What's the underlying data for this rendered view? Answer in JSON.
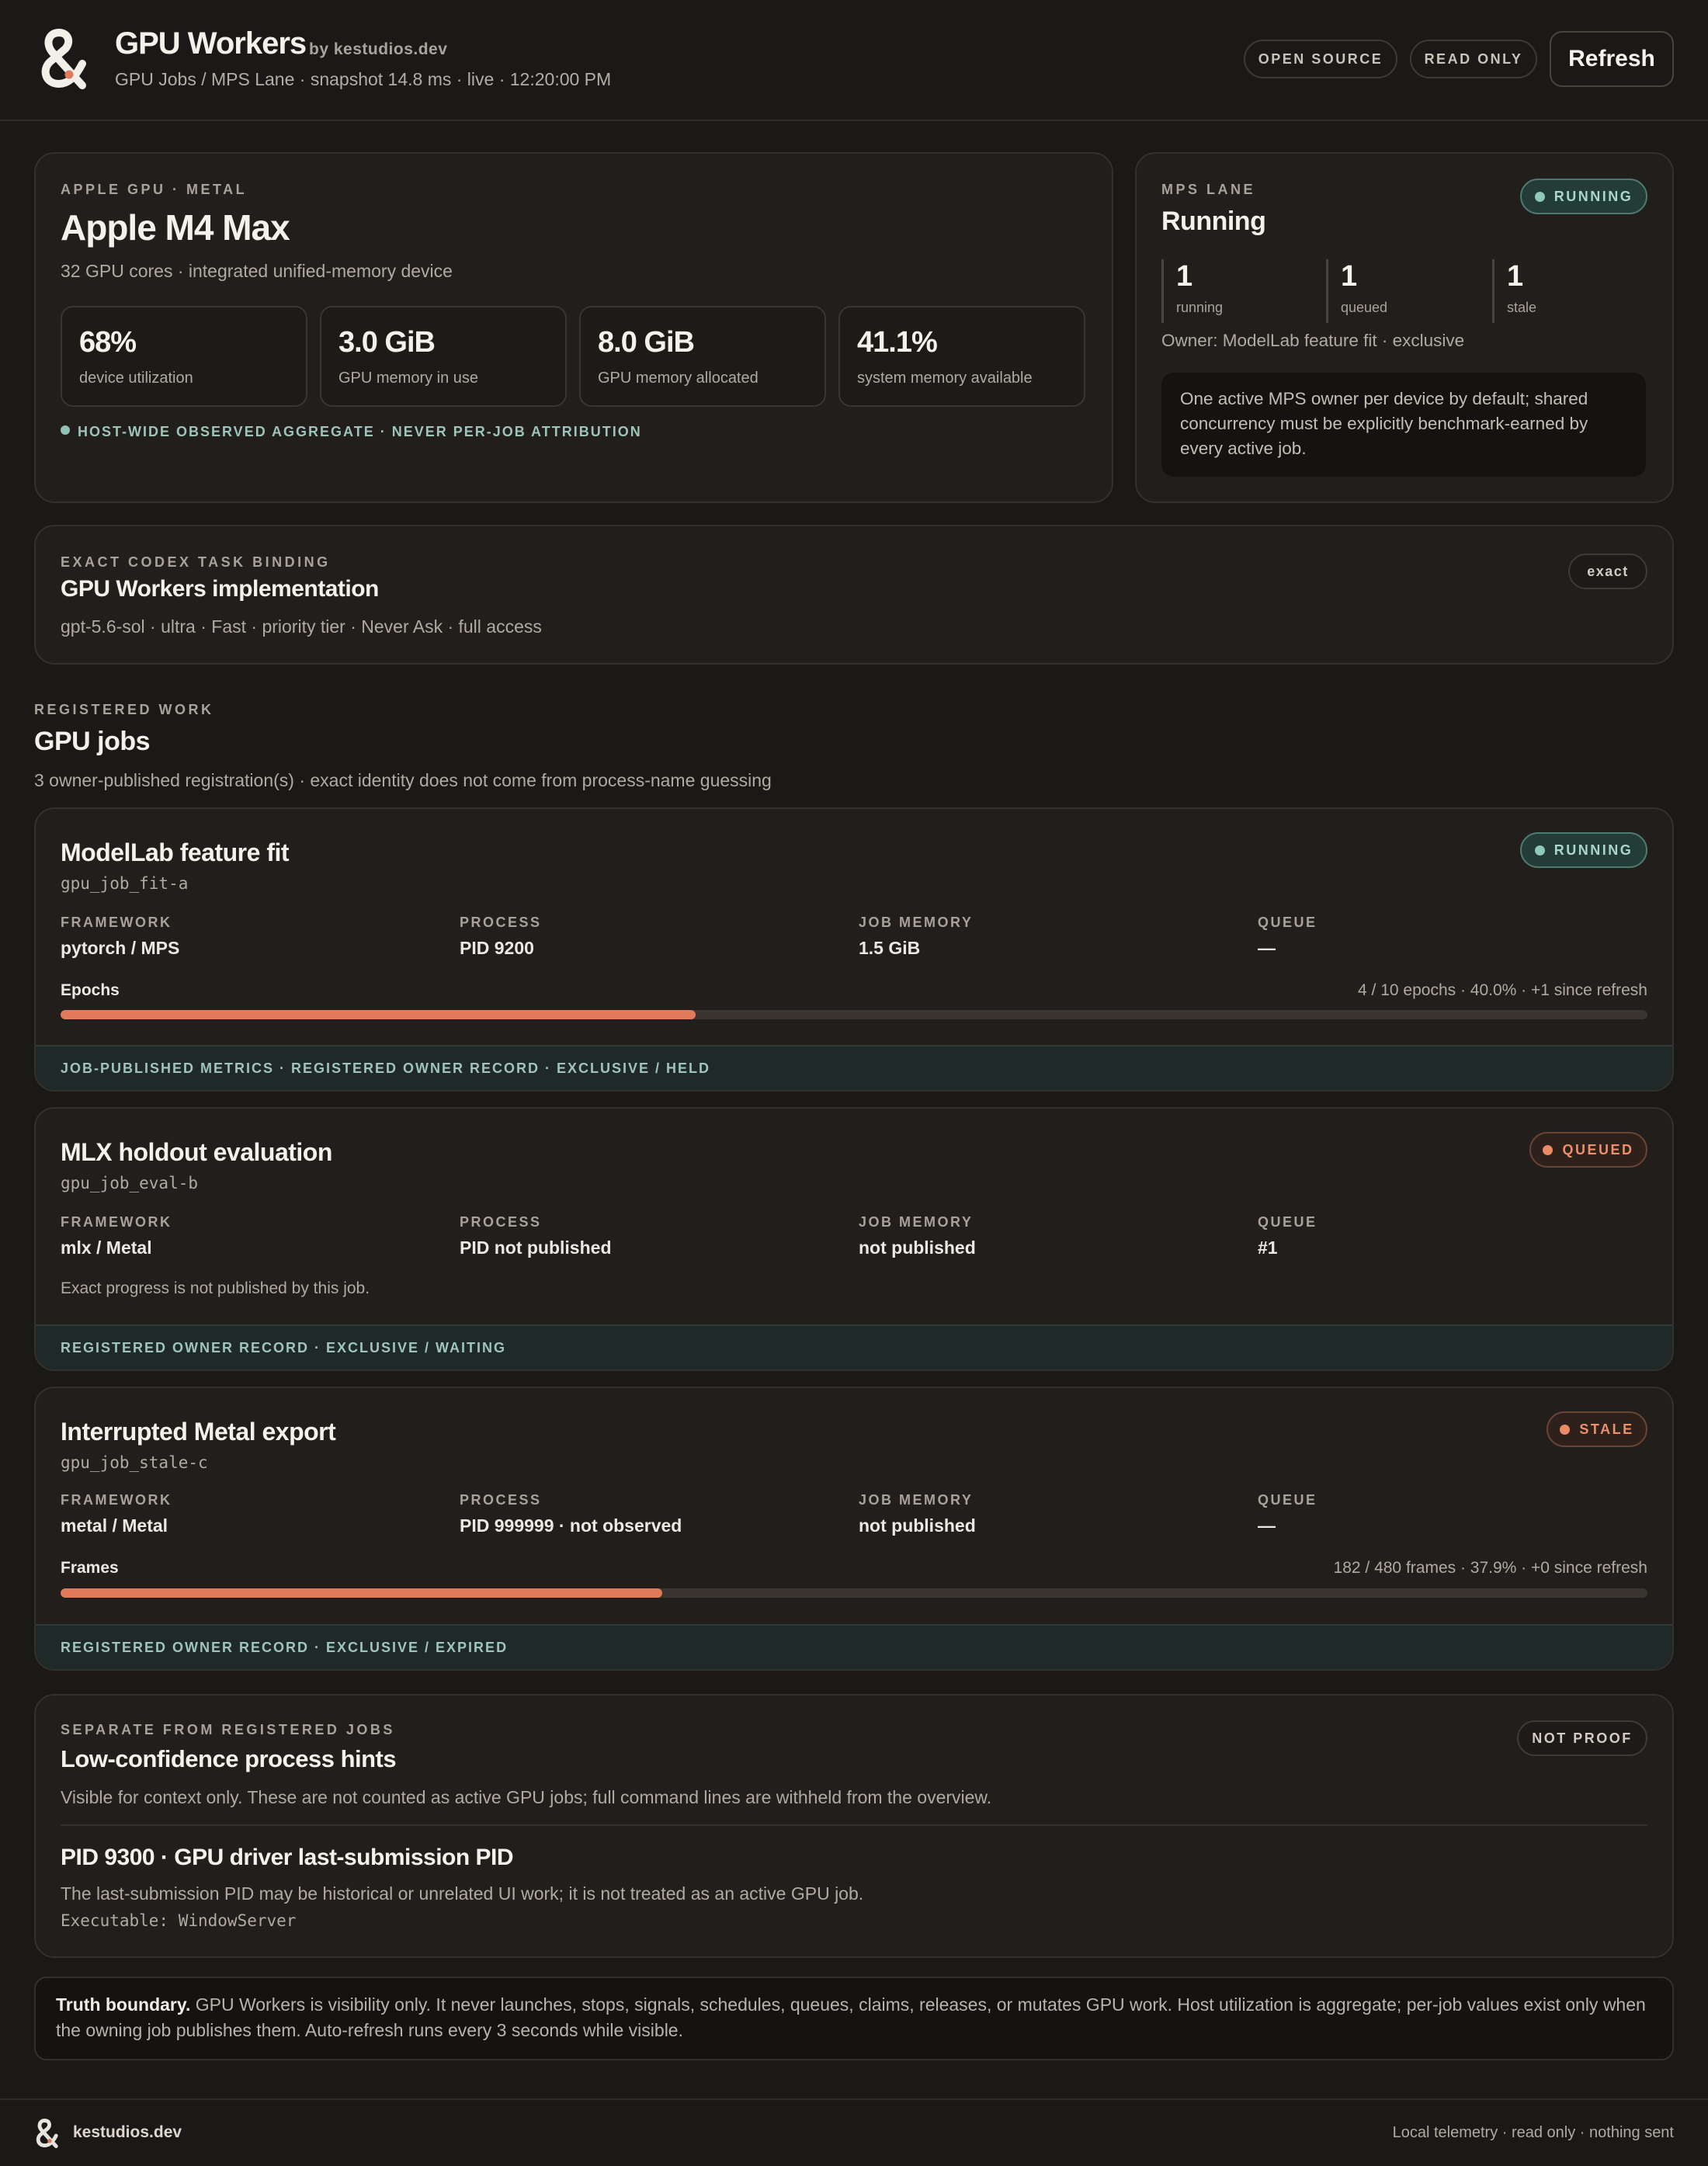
{
  "header": {
    "title": "GPU Workers",
    "byline": "by kestudios.dev",
    "subtitle": "GPU Jobs / MPS Lane · snapshot 14.8 ms · live · 12:20:00 PM",
    "pill_open_source": "OPEN SOURCE",
    "pill_read_only": "READ ONLY",
    "refresh_label": "Refresh",
    "logo_icon": "ampersand-logo-icon"
  },
  "device": {
    "eyebrow": "APPLE GPU · METAL",
    "name": "Apple M4 Max",
    "description": "32 GPU cores · integrated unified-memory device",
    "stats": [
      {
        "value": "68%",
        "label": "device utilization"
      },
      {
        "value": "3.0 GiB",
        "label": "GPU memory in use"
      },
      {
        "value": "8.0 GiB",
        "label": "GPU memory allocated"
      },
      {
        "value": "41.1%",
        "label": "system memory available"
      }
    ],
    "aggregate_note": "HOST-WIDE OBSERVED AGGREGATE · NEVER PER-JOB ATTRIBUTION"
  },
  "mps": {
    "eyebrow": "MPS LANE",
    "state": "Running",
    "badge": "RUNNING",
    "counts": [
      {
        "value": "1",
        "label": "running"
      },
      {
        "value": "1",
        "label": "queued"
      },
      {
        "value": "1",
        "label": "stale"
      }
    ],
    "owner": "Owner: ModelLab feature fit · exclusive",
    "note": "One active MPS owner per device by default; shared concurrency must be explicitly benchmark-earned by every active job."
  },
  "binding": {
    "eyebrow": "EXACT CODEX TASK BINDING",
    "title": "GPU Workers implementation",
    "detail": "gpt-5.6-sol · ultra · Fast · priority tier · Never Ask · full access",
    "badge": "exact"
  },
  "jobs_section": {
    "eyebrow": "REGISTERED WORK",
    "title": "GPU jobs",
    "subtitle": "3 owner-published registration(s) · exact identity does not come from process-name guessing"
  },
  "field_labels": {
    "framework": "FRAMEWORK",
    "process": "PROCESS",
    "memory": "JOB MEMORY",
    "queue": "QUEUE"
  },
  "jobs": [
    {
      "title": "ModelLab feature fit",
      "id": "gpu_job_fit-a",
      "badge": "RUNNING",
      "framework": "pytorch / MPS",
      "process": "PID 9200",
      "memory": "1.5 GiB",
      "queue": "—",
      "progress_label": "Epochs",
      "progress_meta": "4 / 10 epochs · 40.0% · +1 since refresh",
      "progress_fraction": 0.4,
      "footer": "JOB-PUBLISHED METRICS · REGISTERED OWNER RECORD · EXCLUSIVE / HELD"
    },
    {
      "title": "MLX holdout evaluation",
      "id": "gpu_job_eval-b",
      "badge": "QUEUED",
      "framework": "mlx / Metal",
      "process": "PID not published",
      "memory": "not published",
      "queue": "#1",
      "progress_note": "Exact progress is not published by this job.",
      "footer": "REGISTERED OWNER RECORD · EXCLUSIVE / WAITING"
    },
    {
      "title": "Interrupted Metal export",
      "id": "gpu_job_stale-c",
      "badge": "STALE",
      "framework": "metal / Metal",
      "process": "PID 999999 · not observed",
      "memory": "not published",
      "queue": "—",
      "progress_label": "Frames",
      "progress_meta": "182 / 480 frames · 37.9% · +0 since refresh",
      "progress_fraction": 0.379,
      "footer": "REGISTERED OWNER RECORD · EXCLUSIVE / EXPIRED"
    }
  ],
  "hints": {
    "eyebrow": "SEPARATE FROM REGISTERED JOBS",
    "title": "Low-confidence process hints",
    "subtitle": "Visible for context only. These are not counted as active GPU jobs; full command lines are withheld from the overview.",
    "badge": "NOT PROOF",
    "item_title": "PID 9300 · GPU driver last-submission PID",
    "item_detail": "The last-submission PID may be historical or unrelated UI work; it is not treated as an active GPU job.",
    "item_exe": "Executable: WindowServer"
  },
  "truth": {
    "lead": "Truth boundary.",
    "text": " GPU Workers is visibility only. It never launches, stops, signals, schedules, queues, claims, releases, or mutates GPU work. Host utilization is aggregate; per-job values exist only when the owning job publishes them. Auto-refresh runs every 3 seconds while visible."
  },
  "footer": {
    "brand": "kestudios.dev",
    "right": "Local telemetry · read only · nothing sent"
  },
  "colors": {
    "background": "#1b1917",
    "accent": "#e17a5a",
    "running": "#8fc9bb",
    "queued": "#ec8a64"
  }
}
